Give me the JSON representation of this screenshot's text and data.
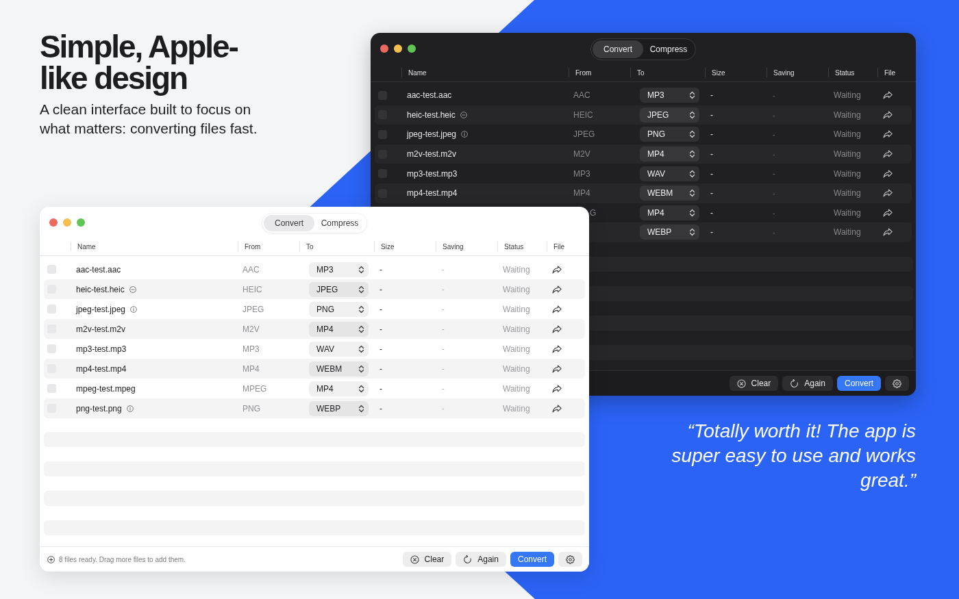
{
  "headline": "Simple, Apple-like design",
  "subheadline": "A clean interface built to focus on what matters: converting files fast.",
  "windows": [
    {
      "kind": "dark",
      "tabs": [
        {
          "label": "Convert",
          "selected": true
        },
        {
          "label": "Compress",
          "selected": false
        }
      ],
      "columns": [
        "Name",
        "From",
        "To",
        "Size",
        "Saving",
        "Status",
        "File"
      ],
      "rows": [
        {
          "checked": false,
          "name": "aac-test.aac",
          "from": "AAC",
          "to": "MP3",
          "size": "-",
          "saving": "-",
          "status": "Waiting"
        },
        {
          "checked": false,
          "name": "heic-test.heic",
          "marker": {
            "kind": "minus"
          },
          "from": "HEIC",
          "to": "JPEG",
          "size": "-",
          "saving": "-",
          "status": "Waiting"
        },
        {
          "checked": false,
          "name": "jpeg-test.jpeg",
          "marker": {
            "kind": "info"
          },
          "from": "JPEG",
          "to": "PNG",
          "size": "-",
          "saving": "-",
          "status": "Waiting"
        },
        {
          "checked": false,
          "name": "m2v-test.m2v",
          "from": "M2V",
          "to": "MP4",
          "size": "-",
          "saving": "-",
          "status": "Waiting"
        },
        {
          "checked": false,
          "name": "mp3-test.mp3",
          "from": "MP3",
          "to": "WAV",
          "size": "-",
          "saving": "-",
          "status": "Waiting"
        },
        {
          "checked": false,
          "name": "mp4-test.mp4",
          "from": "MP4",
          "to": "WEBM",
          "size": "-",
          "saving": "-",
          "status": "Waiting"
        },
        {
          "from": "G",
          "to": "MP4",
          "size": "-",
          "saving": "-",
          "status": "Waiting"
        },
        {
          "to": "WEBP",
          "size": "-",
          "saving": "-",
          "status": "Waiting"
        }
      ],
      "footer": {
        "buttons": [
          {
            "kind": "clear",
            "label": "Clear"
          },
          {
            "kind": "again",
            "label": "Again"
          },
          {
            "kind": "primary",
            "label": "Convert"
          },
          {
            "kind": "settings"
          }
        ]
      }
    },
    {
      "kind": "light",
      "tabs": [
        {
          "label": "Convert",
          "selected": true
        },
        {
          "label": "Compress",
          "selected": false
        }
      ],
      "columns": [
        "Name",
        "From",
        "To",
        "Size",
        "Saving",
        "Status",
        "File"
      ],
      "rows": [
        {
          "checked": false,
          "name": "aac-test.aac",
          "from": "AAC",
          "to": "MP3",
          "size": "-",
          "saving": "-",
          "status": "Waiting"
        },
        {
          "checked": false,
          "name": "heic-test.heic",
          "marker": {
            "kind": "minus"
          },
          "from": "HEIC",
          "to": "JPEG",
          "size": "-",
          "saving": "-",
          "status": "Waiting"
        },
        {
          "checked": false,
          "name": "jpeg-test.jpeg",
          "marker": {
            "kind": "info"
          },
          "from": "JPEG",
          "to": "PNG",
          "size": "-",
          "saving": "-",
          "status": "Waiting"
        },
        {
          "checked": false,
          "name": "m2v-test.m2v",
          "from": "M2V",
          "to": "MP4",
          "size": "-",
          "saving": "-",
          "status": "Waiting"
        },
        {
          "checked": false,
          "name": "mp3-test.mp3",
          "from": "MP3",
          "to": "WAV",
          "size": "-",
          "saving": "-",
          "status": "Waiting"
        },
        {
          "checked": false,
          "name": "mp4-test.mp4",
          "from": "MP4",
          "to": "WEBM",
          "size": "-",
          "saving": "-",
          "status": "Waiting"
        },
        {
          "checked": false,
          "name": "mpeg-test.mpeg",
          "from": "MPEG",
          "to": "MP4",
          "size": "-",
          "saving": "-",
          "status": "Waiting"
        },
        {
          "checked": false,
          "name": "png-test.png",
          "marker": {
            "kind": "info"
          },
          "from": "PNG",
          "to": "WEBP",
          "size": "-",
          "saving": "-",
          "status": "Waiting"
        }
      ],
      "footer": {
        "status": "8 files ready. Drag more files to add them.",
        "buttons": [
          {
            "kind": "clear",
            "label": "Clear"
          },
          {
            "kind": "again",
            "label": "Again"
          },
          {
            "kind": "primary",
            "label": "Convert"
          },
          {
            "kind": "settings"
          }
        ]
      }
    }
  ],
  "testimonial": "“Totally worth it! The app is super easy to use and works great.”"
}
